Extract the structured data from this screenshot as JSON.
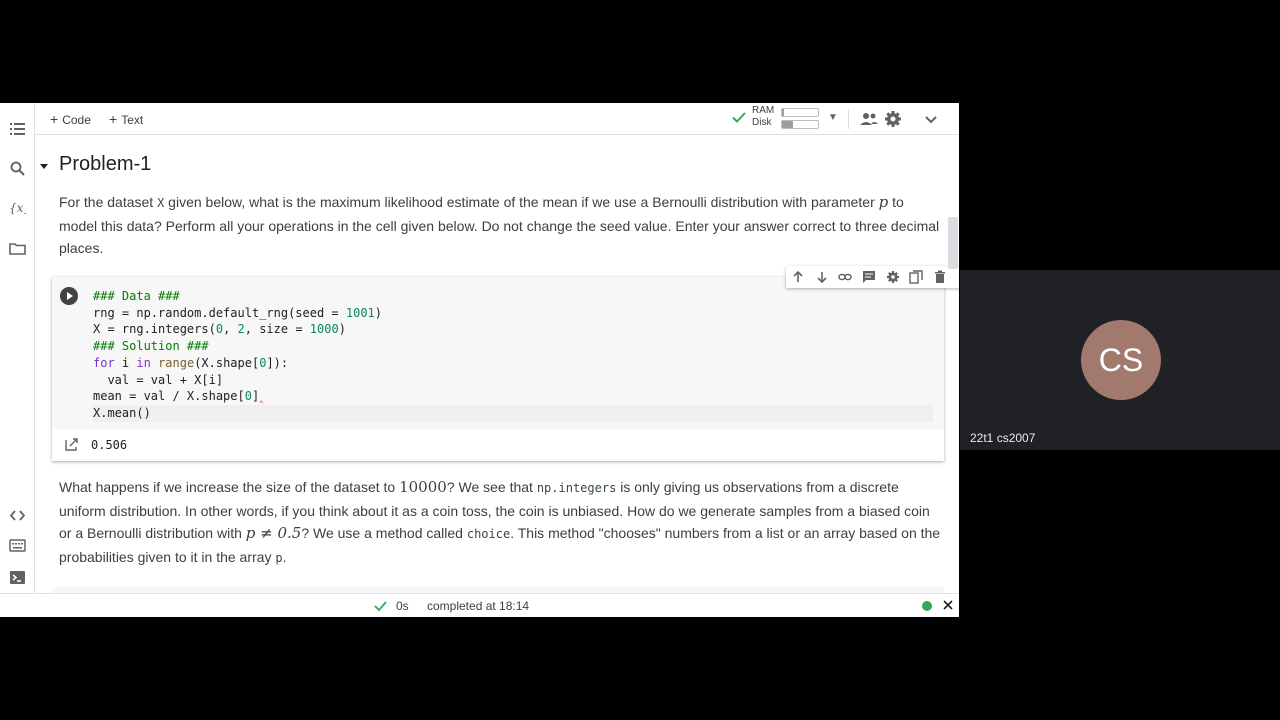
{
  "toolbar": {
    "code_label": "Code",
    "text_label": "Text",
    "ram_label": "RAM",
    "disk_label": "Disk",
    "ram_usage": 0.05,
    "disk_usage": 0.3
  },
  "section": {
    "title": "Problem-1"
  },
  "paragraph1": {
    "a": "For the dataset ",
    "code_x": "X",
    "b": " given below, what is the maximum likelihood estimate of the mean if we use a Bernoulli distribution with parameter ",
    "math_p": "p",
    "c": " to model this data? Perform all your operations in the cell given below. Do not change the seed value. Enter your answer correct to three decimal places."
  },
  "cell": {
    "lines": [
      "### Data ###",
      "rng = np.random.default_rng(seed = 1001)",
      "X = rng.integers(0, 2, size = 1000)",
      "### Solution ###",
      "for i in range(X.shape[0]):",
      "  val = val + X[i]",
      "mean = val / X.shape[0]",
      "X.mean()"
    ],
    "output": "0.506"
  },
  "paragraph2": {
    "a": "What happens if we increase the size of the dataset to ",
    "math_n": "10000",
    "b": "? We see that ",
    "code_integers": "np.integers",
    "c": " is only giving us observations from a discrete uniform distribution. In other words, if you think about it as a coin toss, the coin is unbiased. How do we generate samples from a biased coin or a Bernoulli distribution with ",
    "math_p": "p ≠ 0.5",
    "d": "? We use a method called ",
    "code_choice": "choice",
    "e": ". This method \"chooses\" numbers from a list or an array based on the probabilities given to it in the array ",
    "code_p": "p",
    "f": "."
  },
  "status": {
    "time": "0s",
    "completed": "completed at 18:14"
  },
  "meet": {
    "initials": "CS",
    "name": "22t1 cs2007"
  },
  "colors": {
    "accent_green": "#34a853",
    "avatar": "#a1796d",
    "error_mark": "#e53935"
  }
}
